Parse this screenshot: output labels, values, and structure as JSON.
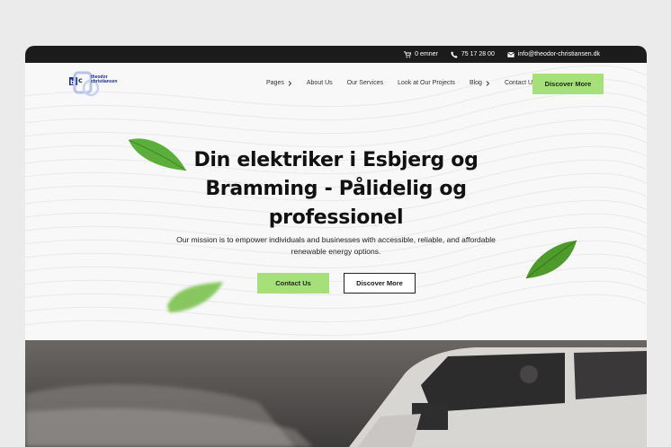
{
  "topbar": {
    "cart_label": "0 emner",
    "phone": "75 17 28 00",
    "email": "info@theodor-christiansen.dk"
  },
  "logo": {
    "text": "theodor christiansen"
  },
  "nav": {
    "items": [
      {
        "label": "Pages",
        "has_chevron": true
      },
      {
        "label": "About Us",
        "has_chevron": false
      },
      {
        "label": "Our Services",
        "has_chevron": false
      },
      {
        "label": "Look at Our Projects",
        "has_chevron": false
      },
      {
        "label": "Blog",
        "has_chevron": true
      },
      {
        "label": "Contact Us",
        "has_chevron": false
      }
    ],
    "cta_label": "Discover More"
  },
  "hero": {
    "title": "Din elektriker i Esbjerg og Bramming - Pålidelig og professionel",
    "subtitle": "Our mission is to empower individuals and businesses with accessible, reliable, and affordable renewable energy options.",
    "primary_button": "Contact Us",
    "secondary_button": "Discover More"
  },
  "colors": {
    "accent": "#a6e07b",
    "topbar": "#1c1c1c",
    "logo_blue": "#1a2f8a"
  }
}
